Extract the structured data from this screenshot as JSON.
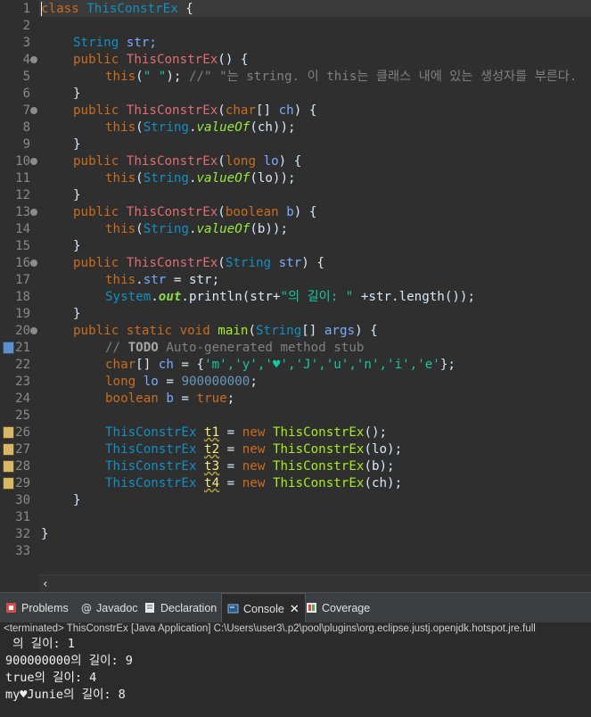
{
  "editor": {
    "line_numbers": [
      "1",
      "2",
      "3",
      "4",
      "5",
      "6",
      "7",
      "8",
      "9",
      "10",
      "11",
      "12",
      "13",
      "14",
      "15",
      "16",
      "17",
      "18",
      "19",
      "20",
      "21",
      "22",
      "23",
      "24",
      "25",
      "26",
      "27",
      "28",
      "29",
      "30",
      "31",
      "32",
      "33"
    ],
    "code": {
      "l1": {
        "k": "class",
        "c": "ThisConstrEx",
        "p": " {"
      },
      "l3": {
        "t": "String",
        "v": "str;"
      },
      "l4": {
        "k": "public",
        "f": "ThisConstrEx",
        "p": "() {"
      },
      "l5": {
        "k": "this",
        "p1": "(",
        "s": "\" \"",
        "p2": "); ",
        "cm": "//\" \"는 string. 이 this는 클래스 내에 있는 생성자를 부른다."
      },
      "l6": {
        "p": "}"
      },
      "l7": {
        "k": "public",
        "f": "ThisConstrEx",
        "p1": "(",
        "k2": "char",
        "p2": "[] ",
        "v": "ch",
        "p3": ") {"
      },
      "l8": {
        "k": "this",
        "p1": "(",
        "t": "String",
        "p2": ".",
        "m": "valueOf",
        "p3": "(ch));"
      },
      "l9": {
        "p": "}"
      },
      "l10": {
        "k": "public",
        "f": "ThisConstrEx",
        "p1": "(",
        "k2": "long",
        "p2": " ",
        "v": "lo",
        "p3": ") {"
      },
      "l11": {
        "k": "this",
        "p1": "(",
        "t": "String",
        "p2": ".",
        "m": "valueOf",
        "p3": "(lo));"
      },
      "l12": {
        "p": "}"
      },
      "l13": {
        "k": "public",
        "f": "ThisConstrEx",
        "p1": "(",
        "k2": "boolean",
        "p2": " ",
        "v": "b",
        "p3": ") {"
      },
      "l14": {
        "k": "this",
        "p1": "(",
        "t": "String",
        "p2": ".",
        "m": "valueOf",
        "p3": "(b));"
      },
      "l15": {
        "p": "}"
      },
      "l16": {
        "k": "public",
        "f": "ThisConstrEx",
        "p1": "(",
        "t": "String",
        "p2": " ",
        "v": "str",
        "p3": ") {"
      },
      "l17": {
        "k": "this",
        "p1": ".",
        "v": "str",
        "p2": " = str;"
      },
      "l18": {
        "t": "System",
        "p1": ".",
        "o": "out",
        "p2": ".println(str+",
        "s": "\"의 길이: \"",
        "p3": " +str.length());"
      },
      "l19": {
        "p": "}"
      },
      "l20": {
        "k": "public static void",
        "f": "main",
        "p1": "(",
        "t": "String",
        "p2": "[] ",
        "v": "args",
        "p3": ") {"
      },
      "l21": {
        "c1": "// ",
        "todo": "TODO",
        "c2": " Auto-generated method stub"
      },
      "l22": {
        "k": "char",
        "p1": "[] ",
        "v": "ch",
        "p2": " = {",
        "s": "'m','y','♥','J','u','n','i','e'",
        "p3": "};"
      },
      "l23": {
        "k": "long",
        "p1": " ",
        "v": "lo",
        "p2": " = ",
        "n": "900000000",
        "p3": ";"
      },
      "l24": {
        "k": "boolean",
        "p1": " ",
        "v": "b",
        "p2": " = ",
        "k2": "true",
        "p3": ";"
      },
      "l26": {
        "t": "ThisConstrEx",
        "v": "t1",
        "p1": " = ",
        "k": "new",
        "f": "ThisConstrEx",
        "p2": "();"
      },
      "l27": {
        "t": "ThisConstrEx",
        "v": "t2",
        "p1": " = ",
        "k": "new",
        "f": "ThisConstrEx",
        "p2": "(lo);"
      },
      "l28": {
        "t": "ThisConstrEx",
        "v": "t3",
        "p1": " = ",
        "k": "new",
        "f": "ThisConstrEx",
        "p2": "(b);"
      },
      "l29": {
        "t": "ThisConstrEx",
        "v": "t4",
        "p1": " = ",
        "k": "new",
        "f": "ThisConstrEx",
        "p2": "(ch);"
      },
      "l30": {
        "p": "}"
      },
      "l32": {
        "p": "}"
      }
    },
    "scroll_left_glyph": "‹"
  },
  "tabs": [
    {
      "label": "Problems",
      "icon": "problems-icon"
    },
    {
      "label": "Javadoc",
      "icon": "javadoc-icon"
    },
    {
      "label": "Declaration",
      "icon": "declaration-icon"
    },
    {
      "label": "Console",
      "icon": "console-icon",
      "active": true,
      "close": "✕"
    },
    {
      "label": "Coverage",
      "icon": "coverage-icon"
    }
  ],
  "status": "<terminated> ThisConstrEx [Java Application] C:\\Users\\user3\\.p2\\pool\\plugins\\org.eclipse.justj.openjdk.hotspot.jre.full",
  "console_output": [
    " 의 길이: 1",
    "900000000의 길이: 9",
    "true의 길이: 4",
    "my♥Junie의 길이: 8"
  ],
  "colors": {
    "keyword": "#cc6c1d",
    "type": "#1290c3",
    "string": "#17c6a3",
    "comment": "#808080",
    "method": "#a7ec21",
    "number": "#6897bb",
    "background": "#2f2f2f"
  }
}
